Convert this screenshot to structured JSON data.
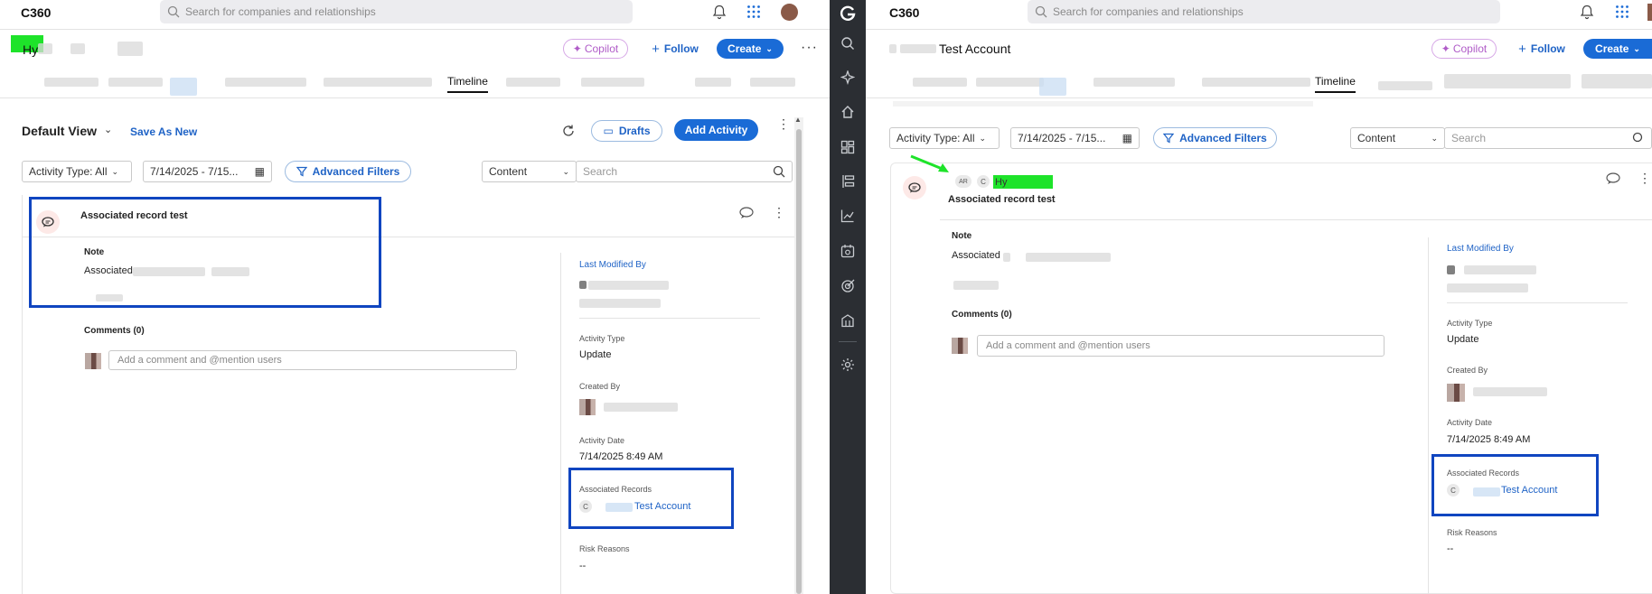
{
  "left": {
    "app_title": "C360",
    "search_placeholder": "Search for companies and relationships",
    "header_name": "Hy",
    "copilot_label": "Copilot",
    "follow_label": "Follow",
    "create_label": "Create",
    "active_tab": "Timeline",
    "view_name": "Default View",
    "save_as_new": "Save As New",
    "drafts_label": "Drafts",
    "add_activity_label": "Add Activity",
    "activity_type_filter": "Activity Type: All",
    "date_range": "7/14/2025 - 7/15...",
    "advanced_filters": "Advanced Filters",
    "content_select": "Content",
    "search_placeholder2": "Search",
    "activity": {
      "title": "Associated record test",
      "note_label": "Note",
      "note_text": "Associated",
      "comments_label": "Comments (0)",
      "comment_placeholder": "Add a comment and @mention users",
      "last_modified_by_label": "Last Modified By",
      "activity_type_label": "Activity Type",
      "activity_type_value": "Update",
      "created_by_label": "Created By",
      "activity_date_label": "Activity Date",
      "activity_date_value": "7/14/2025 8:49 AM",
      "associated_records_label": "Associated Records",
      "associated_record_badge": "C",
      "associated_record_value": "Test Account",
      "risk_reasons_label": "Risk Reasons",
      "risk_reasons_value": "--"
    }
  },
  "right": {
    "app_title": "C360",
    "search_placeholder": "Search for companies and relationships",
    "header_name": "Test Account",
    "copilot_label": "Copilot",
    "follow_label": "Follow",
    "create_label": "Create",
    "active_tab": "Timeline",
    "activity_type_filter": "Activity Type: All",
    "date_range": "7/14/2025 - 7/15...",
    "advanced_filters": "Advanced Filters",
    "content_select": "Content",
    "search_placeholder2": "Search",
    "activity": {
      "author_badge_ar": "AR",
      "author_badge_c": "C",
      "author_name": "Hy",
      "title": "Associated record test",
      "note_label": "Note",
      "note_text": "Associated",
      "comments_label": "Comments (0)",
      "comment_placeholder": "Add a comment and @mention users",
      "last_modified_by_label": "Last Modified By",
      "activity_type_label": "Activity Type",
      "activity_type_value": "Update",
      "created_by_label": "Created By",
      "activity_date_label": "Activity Date",
      "activity_date_value": "7/14/2025 8:49 AM",
      "associated_records_label": "Associated Records",
      "associated_record_badge": "C",
      "associated_record_value": "Test Account",
      "risk_reasons_label": "Risk Reasons",
      "risk_reasons_value": "--"
    }
  },
  "sidebar": {
    "icons": [
      "gainsight-logo-icon",
      "search-icon",
      "sparkle-icon",
      "home-icon",
      "dashboard-icon",
      "timeline-icon",
      "analytics-icon",
      "calendar-icon",
      "target-icon",
      "building-icon",
      "settings-icon"
    ]
  },
  "colors": {
    "accent": "#1a6bd6",
    "highlight_border": "#1045c0",
    "sidebar_bg": "#2b2e33",
    "marker_green": "#1ee32a"
  }
}
